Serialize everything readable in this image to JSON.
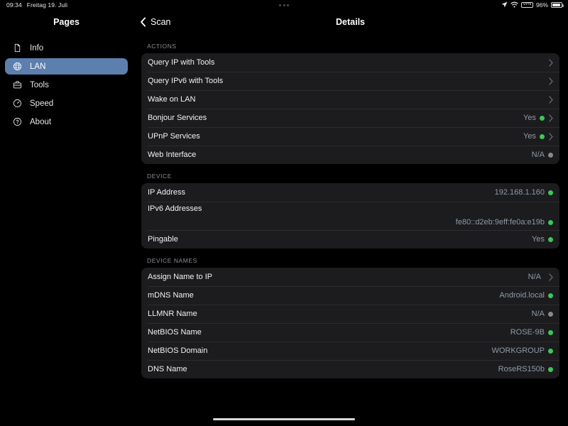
{
  "status_bar": {
    "time": "09:34",
    "date": "Freitag 19. Juli",
    "location_icon": "location-arrow-icon",
    "wifi_icon": "wifi-icon",
    "vpn_label": "VPN",
    "battery_percent": "96%",
    "battery_icon": "battery-icon",
    "multitask_icon": "multitasking-dots-icon"
  },
  "sidebar": {
    "title": "Pages",
    "items": [
      {
        "label": "Info",
        "icon": "document-icon",
        "selected": false
      },
      {
        "label": "LAN",
        "icon": "globe-network-icon",
        "selected": true
      },
      {
        "label": "Tools",
        "icon": "briefcase-icon",
        "selected": false
      },
      {
        "label": "Speed",
        "icon": "speedometer-icon",
        "selected": false
      },
      {
        "label": "About",
        "icon": "question-circle-icon",
        "selected": false
      }
    ]
  },
  "navbar": {
    "back_label": "Scan",
    "back_icon": "chevron-left-icon",
    "title": "Details"
  },
  "colors": {
    "accent_selection": "#5d7fae",
    "status_green": "#3ac75a",
    "status_gray": "#8a8a8e",
    "card_background": "#1c1c1e",
    "value_text": "#8e9aa8"
  },
  "sections": [
    {
      "header": "ACTIONS",
      "rows": [
        {
          "label": "Query IP with Tools",
          "value": "",
          "dot": "none",
          "chevron": true
        },
        {
          "label": "Query IPv6 with Tools",
          "value": "",
          "dot": "none",
          "chevron": true
        },
        {
          "label": "Wake on LAN",
          "value": "",
          "dot": "none",
          "chevron": true
        },
        {
          "label": "Bonjour Services",
          "value": "Yes",
          "dot": "on",
          "chevron": true
        },
        {
          "label": "UPnP Services",
          "value": "Yes",
          "dot": "on",
          "chevron": true
        },
        {
          "label": "Web Interface",
          "value": "N/A",
          "dot": "off",
          "chevron": false
        }
      ]
    },
    {
      "header": "DEVICE",
      "rows": [
        {
          "label": "IP Address",
          "value": "192.168.1.160",
          "dot": "on",
          "chevron": false
        },
        {
          "label": "IPv6 Addresses",
          "value": "fe80::d2eb:9eff:fe0a:e19b",
          "dot": "on",
          "chevron": false,
          "twoline": true
        },
        {
          "label": "Pingable",
          "value": "Yes",
          "dot": "on",
          "chevron": false
        }
      ]
    },
    {
      "header": "DEVICE NAMES",
      "rows": [
        {
          "label": "Assign Name to IP",
          "value": "N/A",
          "dot": "none",
          "chevron": true
        },
        {
          "label": "mDNS Name",
          "value": "Android.local",
          "dot": "on",
          "chevron": false
        },
        {
          "label": "LLMNR Name",
          "value": "N/A",
          "dot": "off",
          "chevron": false
        },
        {
          "label": "NetBIOS Name",
          "value": "ROSE-9B",
          "dot": "on",
          "chevron": false
        },
        {
          "label": "NetBIOS Domain",
          "value": "WORKGROUP",
          "dot": "on",
          "chevron": false
        },
        {
          "label": "DNS Name",
          "value": "RoseRS150b",
          "dot": "on",
          "chevron": false
        }
      ]
    }
  ],
  "home_indicator": "home-indicator-bar"
}
